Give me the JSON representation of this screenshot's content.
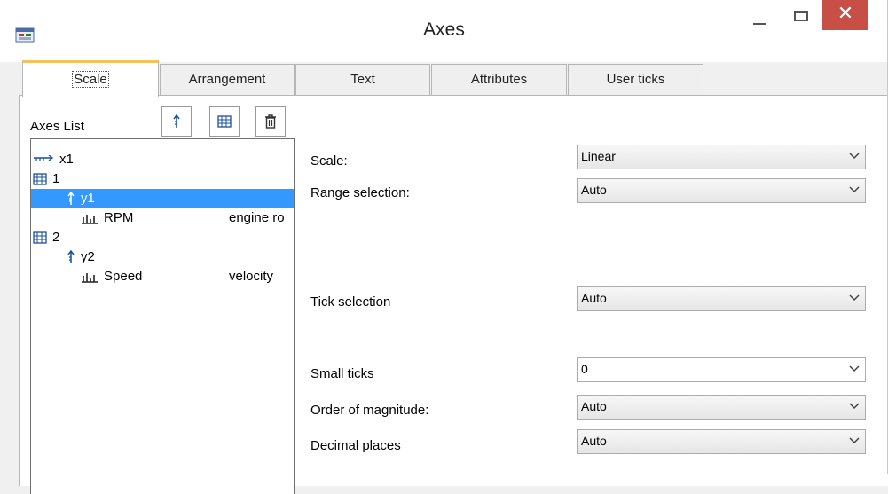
{
  "window": {
    "title": "Axes",
    "close_glyph": "✕"
  },
  "tabs": [
    {
      "label": "Scale",
      "active": true
    },
    {
      "label": "Arrangement",
      "active": false
    },
    {
      "label": "Text",
      "active": false
    },
    {
      "label": "Attributes",
      "active": false
    },
    {
      "label": "User ticks",
      "active": false
    }
  ],
  "axes_list": {
    "label": "Axes List",
    "toolbar": [
      "add-axis-icon",
      "add-system-icon",
      "delete-icon"
    ],
    "tree": [
      {
        "icon": "x-axis-icon",
        "label": "x1",
        "desc": ""
      },
      {
        "icon": "system-icon",
        "label": "1",
        "desc": ""
      },
      {
        "icon": "y-axis-icon",
        "label": "y1",
        "desc": "",
        "selected": true
      },
      {
        "icon": "channel-icon",
        "label": "RPM",
        "desc": "engine ro"
      },
      {
        "icon": "system-icon",
        "label": "2",
        "desc": ""
      },
      {
        "icon": "y-axis-icon",
        "label": "y2",
        "desc": ""
      },
      {
        "icon": "channel-icon",
        "label": "Speed",
        "desc": "velocity"
      }
    ]
  },
  "settings": {
    "scale": {
      "label": "Scale:",
      "value": "Linear"
    },
    "range_selection": {
      "label": "Range selection:",
      "value": "Auto"
    },
    "tick_selection": {
      "label": "Tick selection",
      "value": "Auto"
    },
    "small_ticks": {
      "label": "Small ticks",
      "value": "0"
    },
    "order_of_magnitude": {
      "label": "Order of magnitude:",
      "value": "Auto"
    },
    "decimal_places": {
      "label": "Decimal places",
      "value": "Auto"
    }
  },
  "colors": {
    "selection": "#3399ff",
    "close_button": "#c74f46",
    "active_tab_accent": "#f4c15a",
    "icon_blue": "#1a4f9c"
  }
}
